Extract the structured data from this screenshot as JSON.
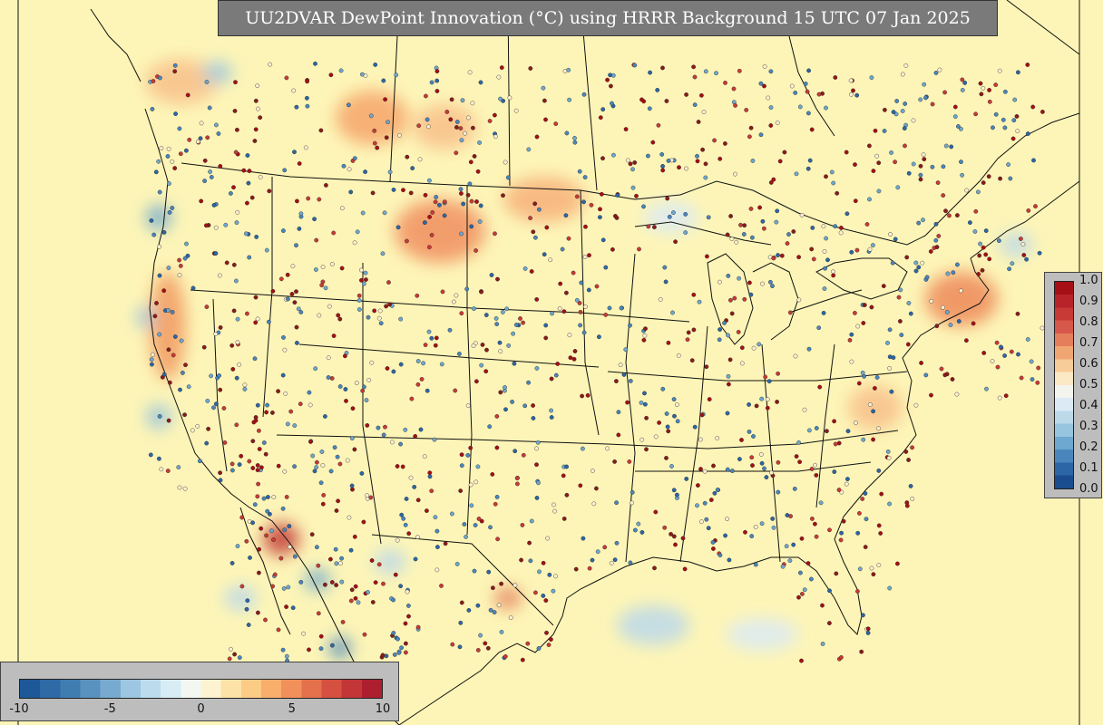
{
  "title": "UU2DVAR DewPoint Innovation (°C) using HRRR Background 15 UTC 07 Jan 2025",
  "title_html_unit": "(oC)",
  "background_color": "#fdf5b7",
  "colorbar_right": {
    "ticks": [
      "1.0",
      "0.9",
      "0.8",
      "0.7",
      "0.6",
      "0.5",
      "0.4",
      "0.3",
      "0.2",
      "0.1",
      "0.0"
    ],
    "colors": [
      "#a50f15",
      "#b8232a",
      "#c83a36",
      "#d6584a",
      "#e57e5b",
      "#f0a672",
      "#f8cc98",
      "#fbe8c4",
      "#f4f4ee",
      "#dbeaf4",
      "#bcd9ea",
      "#97c4df",
      "#6ea7cf",
      "#4a86bd",
      "#2c66a6",
      "#1a4c8f"
    ]
  },
  "colorbar_bottom": {
    "ticks": [
      "-10",
      "-5",
      "0",
      "5",
      "10"
    ],
    "colors": [
      "#1d5898",
      "#2f6aa6",
      "#3f7db1",
      "#5a92bf",
      "#78aacf",
      "#9cc6e2",
      "#bcdcee",
      "#d8ecf5",
      "#f2f7f1",
      "#fdf3d0",
      "#fde2a8",
      "#fccb85",
      "#f9ae6b",
      "#f2905b",
      "#e5704c",
      "#d55040",
      "#c33537",
      "#ad1f2f"
    ]
  }
}
